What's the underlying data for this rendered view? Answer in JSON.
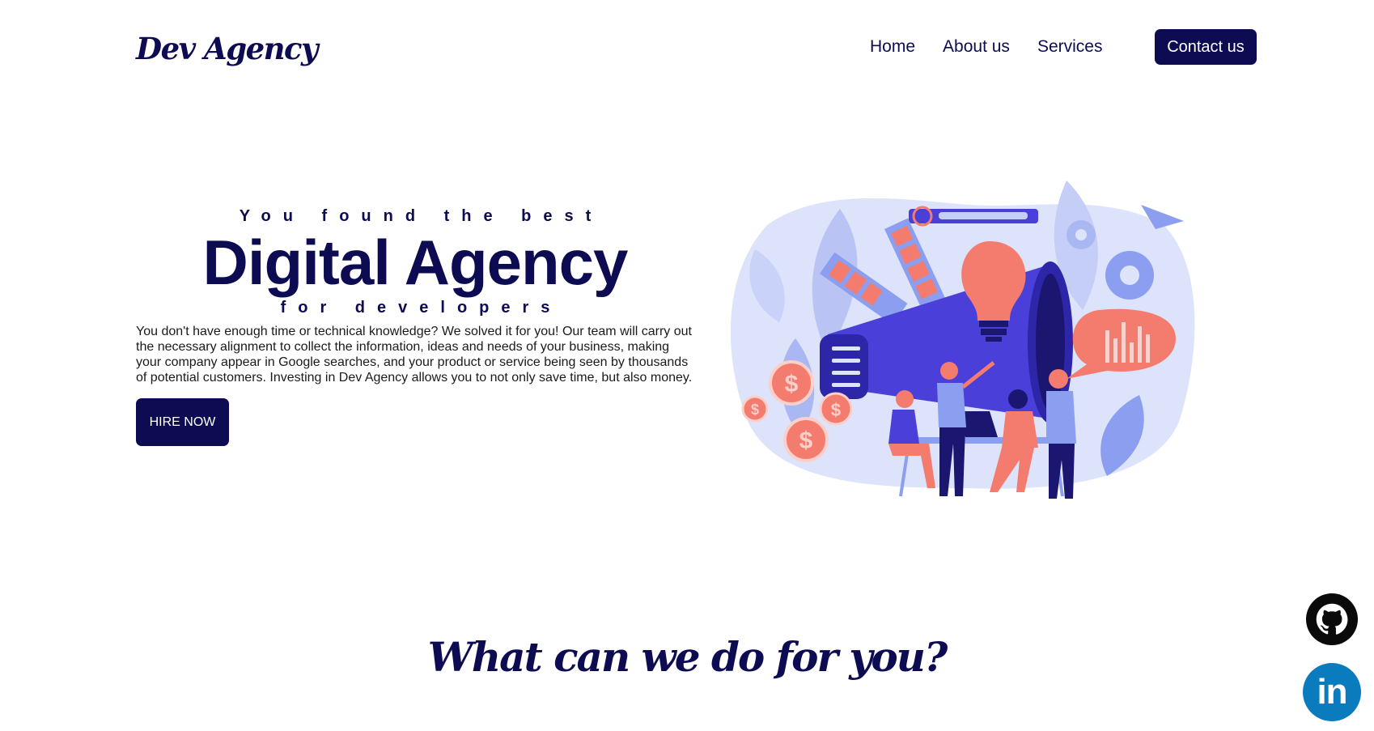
{
  "header": {
    "logo": "Dev Agency",
    "nav": [
      "Home",
      "About us",
      "Services"
    ],
    "contact_label": "Contact us"
  },
  "hero": {
    "eyebrow": "You found the best",
    "title": "Digital Agency",
    "subtitle": "for developers",
    "description": "You don't have enough time or technical knowledge? We solved it for you! Our team will carry out the necessary alignment to collect the information, ideas and needs of your business, making your company appear in Google searches, and your product or service being seen by thousands of potential customers. Investing in Dev Agency allows you to not only save time, but also money.",
    "cta_label": "HIRE NOW"
  },
  "services": {
    "title": "What can we do for you?"
  },
  "social": {
    "linkedin_glyph": "in"
  },
  "icons": [
    "github-icon",
    "linkedin-icon"
  ],
  "colors": {
    "primary": "#0d0c52",
    "accent_blue": "#4a3fd9",
    "accent_coral": "#f47c6e",
    "light_blue": "#dde3fb",
    "linkedin": "#0a7bbd",
    "github": "#0a0a0a"
  }
}
